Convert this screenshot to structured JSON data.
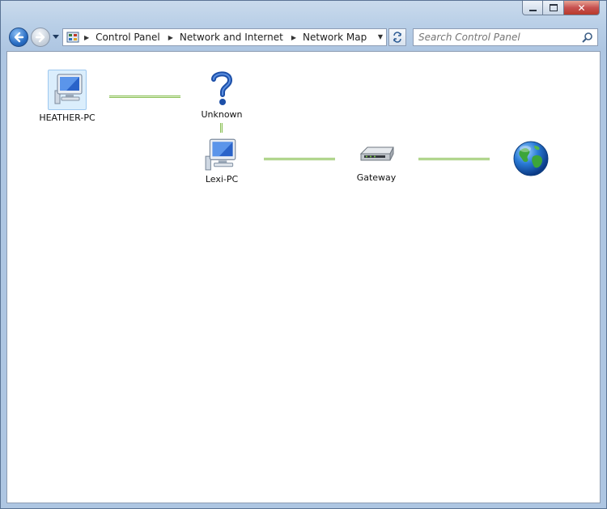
{
  "window": {
    "caption_buttons": {
      "minimize_icon": "minimize-icon",
      "maximize_icon": "maximize-icon",
      "close_label": "✕"
    }
  },
  "navigation": {
    "back_icon": "back-arrow-icon",
    "forward_icon": "forward-arrow-icon",
    "recent_icon": "chevron-down-icon"
  },
  "address_bar": {
    "breadcrumbs": [
      {
        "label": "Control Panel"
      },
      {
        "label": "Network and Internet"
      },
      {
        "label": "Network Map"
      }
    ]
  },
  "search": {
    "placeholder": "Search Control Panel"
  },
  "network_map": {
    "nodes": [
      {
        "id": "heather",
        "label": "HEATHER-PC",
        "icon": "computer-icon",
        "selected": true
      },
      {
        "id": "unknown",
        "label": "Unknown",
        "icon": "question-mark-icon"
      },
      {
        "id": "lexi",
        "label": "Lexi-PC",
        "icon": "computer-icon"
      },
      {
        "id": "gateway",
        "label": "Gateway",
        "icon": "router-icon"
      },
      {
        "id": "internet",
        "label": "",
        "icon": "globe-icon"
      }
    ],
    "colors": {
      "link_fill": "#e3f2d2",
      "link_border": "#8cc05a"
    }
  }
}
